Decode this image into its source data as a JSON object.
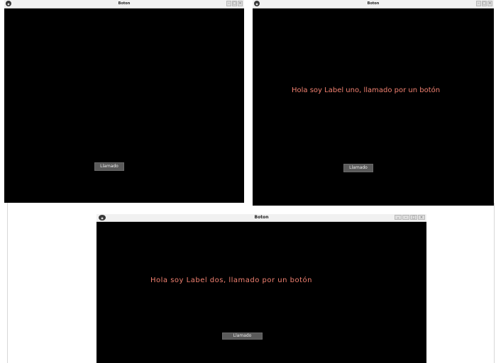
{
  "windows": [
    {
      "title": "Boton",
      "label": "",
      "button": "Llamado"
    },
    {
      "title": "Boton",
      "label": "Hola soy Label uno, llamado por un botón",
      "button": "Llamado"
    },
    {
      "title": "Boton",
      "label": "Hola soy Label dos, llamado por un botón",
      "button": "Llamado"
    }
  ],
  "icons": [
    "app-icon",
    "minimize-icon",
    "maximize-icon",
    "close-icon"
  ],
  "colors": {
    "label": "#f08070",
    "button_bg": "#5a5a5a",
    "titlebar_bg": "#f1f1f1",
    "window_bg": "#000000"
  }
}
